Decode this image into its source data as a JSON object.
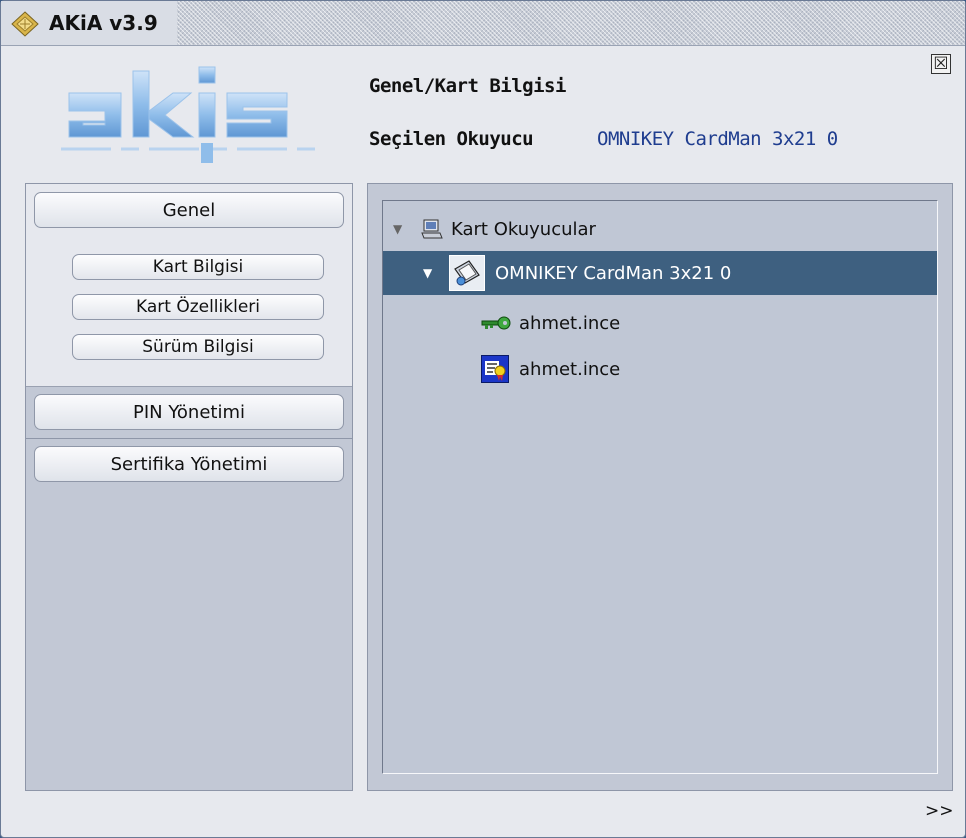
{
  "window": {
    "title": "AKiA v3.9",
    "close_symbol": "☒"
  },
  "logo": {
    "text": "akis"
  },
  "header": {
    "section_title": "Genel/Kart Bilgisi",
    "reader_label": "Seçilen Okuyucu",
    "reader_value": "OMNIKEY CardMan 3x21 0"
  },
  "sidebar": {
    "genel": "Genel",
    "sub_items": [
      "Kart Bilgisi",
      "Kart Özellikleri",
      "Sürüm Bilgisi"
    ],
    "pin": "PIN Yönetimi",
    "sertifika": "Sertifika Yönetimi"
  },
  "tree": {
    "root": {
      "label": "Kart Okuyucular",
      "icon": "computer-icon"
    },
    "reader": {
      "label": "OMNIKEY CardMan 3x21 0",
      "icon": "card-reader-icon",
      "selected": true
    },
    "children": [
      {
        "label": "ahmet.ince",
        "icon": "key-icon"
      },
      {
        "label": "ahmet.ince",
        "icon": "certificate-icon"
      }
    ]
  },
  "footer": {
    "more": ">>"
  },
  "colors": {
    "selection": "#3e6080",
    "reader_value": "#1f3d8f",
    "panel": "#c2c8d5",
    "logo": "#7eb2e6"
  }
}
